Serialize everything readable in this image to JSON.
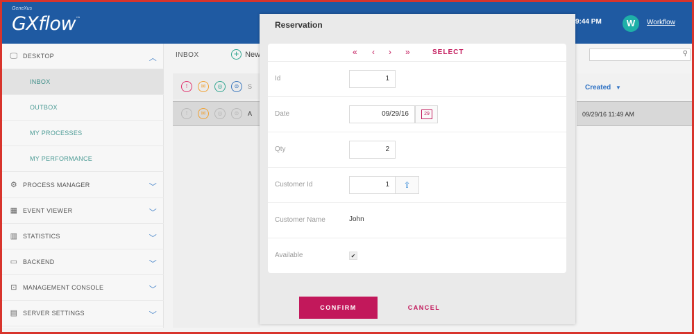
{
  "header": {
    "brand_small": "GeneXus",
    "logo": "GXflow",
    "time": "9:44 PM",
    "avatar_initial": "W",
    "user_link": "Workflow",
    "bg_color": "#1f5aa2"
  },
  "sidebar": {
    "desktop": "DESKTOP",
    "sub_items": [
      "INBOX",
      "OUTBOX",
      "MY PROCESSES",
      "MY PERFORMANCE"
    ],
    "items": [
      {
        "label": "PROCESS MANAGER",
        "icon": "gear-icon"
      },
      {
        "label": "EVENT VIEWER",
        "icon": "event-icon"
      },
      {
        "label": "STATISTICS",
        "icon": "stats-icon"
      },
      {
        "label": "BACKEND",
        "icon": "backend-icon"
      },
      {
        "label": "MANAGEMENT CONSOLE",
        "icon": "console-icon"
      },
      {
        "label": "SERVER SETTINGS",
        "icon": "settings-icon"
      }
    ]
  },
  "toolbar": {
    "breadcrumb": "INBOX",
    "new_label": "New"
  },
  "list": {
    "head_text": "S",
    "row_text": "A",
    "created_label": "Created",
    "row_created": "09/29/16 11:49 AM"
  },
  "modal": {
    "title": "Reservation",
    "select_label": "SELECT",
    "fields": {
      "id_label": "Id",
      "id_value": "1",
      "date_label": "Date",
      "date_value": "09/29/16",
      "cal_day": "29",
      "qty_label": "Qty",
      "qty_value": "2",
      "customer_id_label": "Customer Id",
      "customer_id_value": "1",
      "customer_name_label": "Customer Name",
      "customer_name_value": "John",
      "available_label": "Available",
      "available_checked": "✔"
    },
    "confirm_label": "CONFIRM",
    "cancel_label": "CANCEL",
    "accent_color": "#c2185b"
  }
}
